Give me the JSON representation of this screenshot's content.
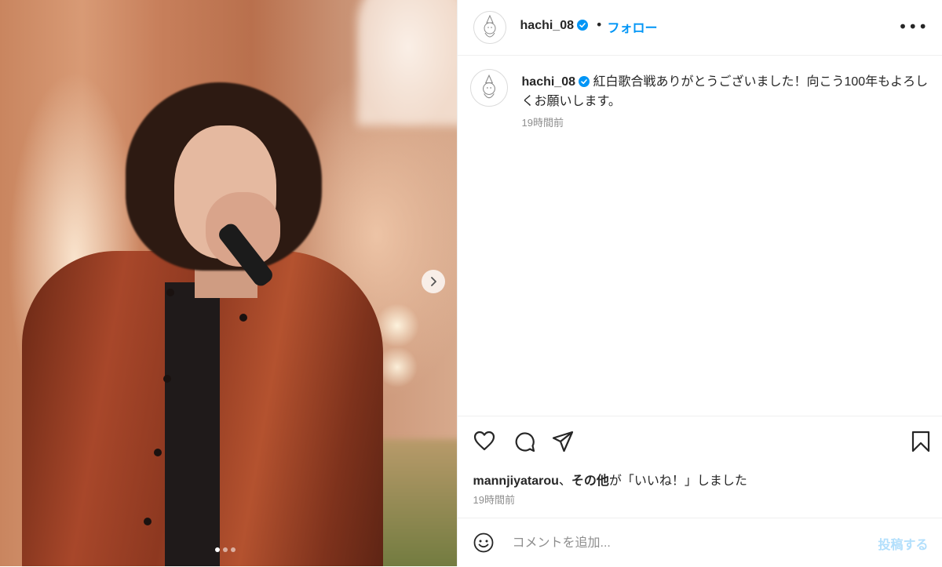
{
  "post": {
    "username": "hachi_08",
    "separator": "•",
    "follow_label": "フォロー",
    "more_label": "•••",
    "caption_text": "紅白歌合戦ありがとうございました！向こう100年もよろしくお願いします。",
    "caption_time": "19時間前"
  },
  "media": {
    "carousel_total": 3,
    "carousel_active": 1,
    "next_icon": "chevron-right-icon"
  },
  "actions": {
    "icons": [
      "heart-icon",
      "comment-icon",
      "share-icon",
      "bookmark-icon"
    ],
    "liked_by_user": "mannjiyatarou",
    "liked_by_sep": "、",
    "liked_by_others": "その他",
    "liked_by_suffix": "が「いいね！」しました",
    "time": "19時間前"
  },
  "comment": {
    "placeholder": "コメントを追加...",
    "post_label": "投稿する"
  },
  "colors": {
    "accent": "#0095f6",
    "text": "#262626",
    "muted": "#8e8e8e",
    "post_disabled": "#b2dffc"
  }
}
